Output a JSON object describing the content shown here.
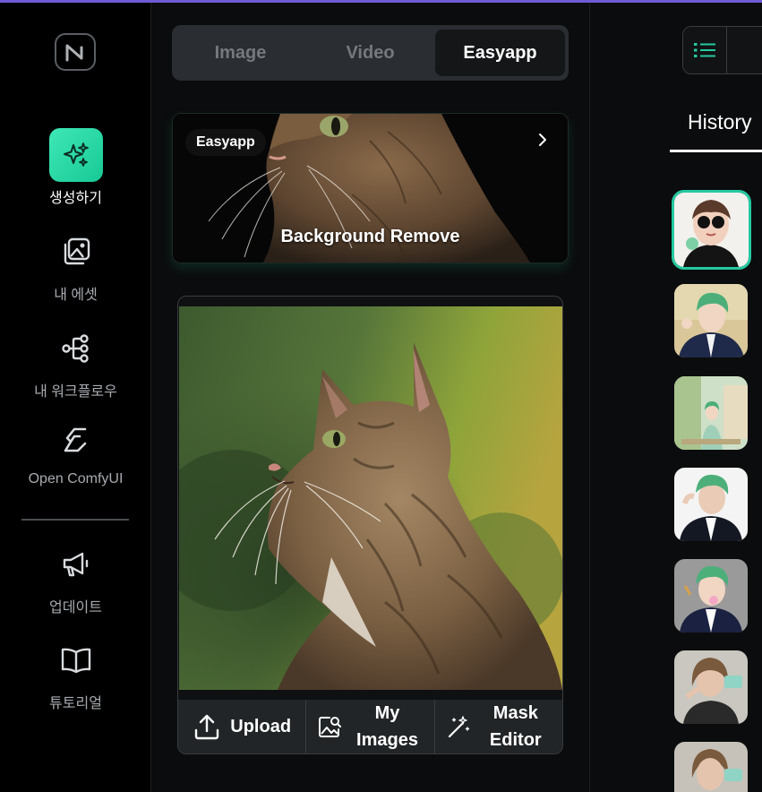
{
  "sidebar": {
    "items": [
      {
        "label": "생성하기",
        "icon": "sparkles-icon"
      },
      {
        "label": "내 에셋",
        "icon": "image-gallery-icon"
      },
      {
        "label": "내 워크플로우",
        "icon": "workflow-icon"
      },
      {
        "label": "Open ComfyUI",
        "icon": "comfyui-icon"
      },
      {
        "label": "업데이트",
        "icon": "megaphone-icon"
      },
      {
        "label": "튜토리얼",
        "icon": "book-icon"
      }
    ]
  },
  "tabs": [
    {
      "label": "Image"
    },
    {
      "label": "Video"
    },
    {
      "label": "Easyapp"
    }
  ],
  "active_tab": "Easyapp",
  "banner": {
    "tag": "Easyapp",
    "title": "Background Remove"
  },
  "actions": {
    "upload": "Upload",
    "my_images": "My Images",
    "mask_editor": "Mask Editor"
  },
  "right": {
    "history_label": "History"
  },
  "colors": {
    "accent": "#25c9a0",
    "top_line": "#6f5bd6"
  }
}
